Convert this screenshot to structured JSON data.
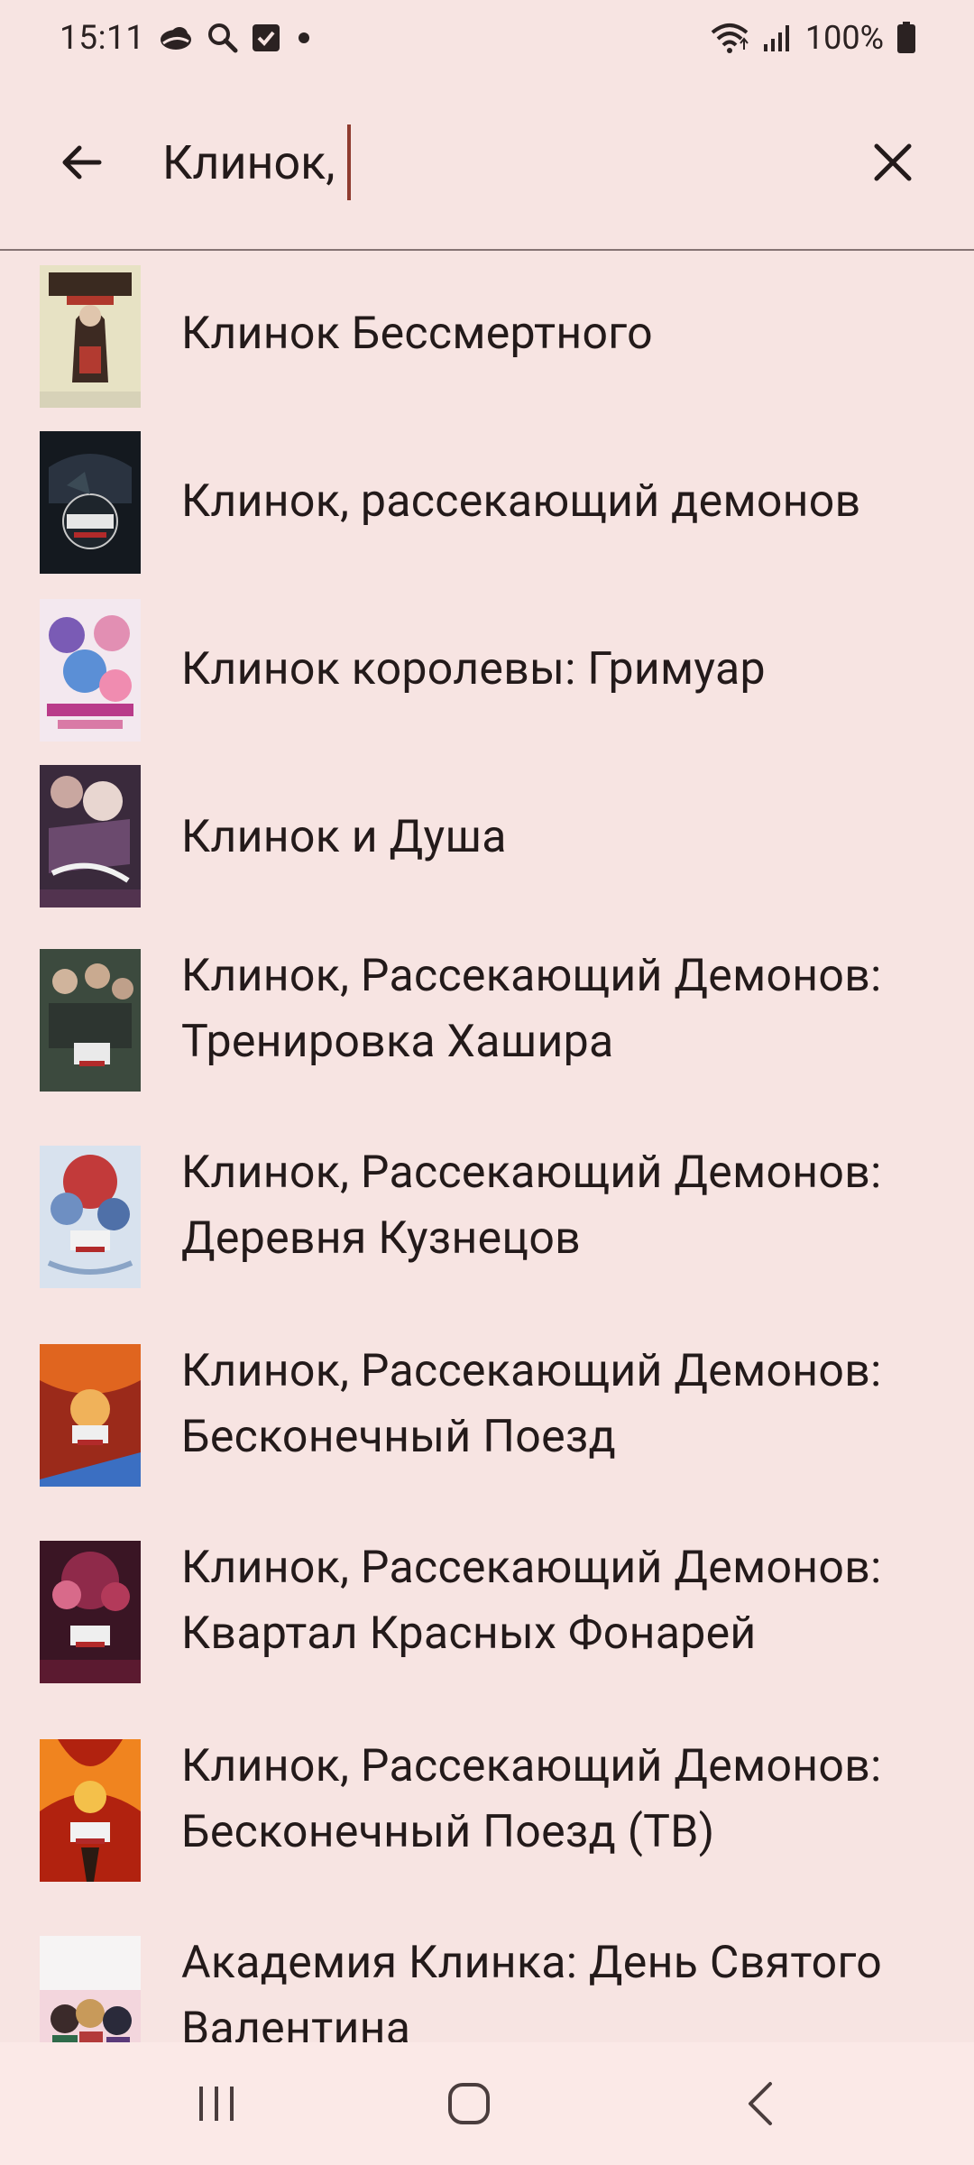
{
  "status_bar": {
    "time": "15:11",
    "battery": "100%",
    "icons": [
      "cloud-icon",
      "search-icon",
      "checkbox-icon",
      "dot-icon",
      "wifi-icon",
      "signal-icon",
      "battery-icon"
    ]
  },
  "search": {
    "query": "Клинок,",
    "back_icon": "arrow-back-icon",
    "clear_icon": "close-icon",
    "accent_color": "#8f3b2f"
  },
  "results": [
    {
      "title": "Клинок Бессмертного",
      "poster": "poster-blade-of-the-immortal"
    },
    {
      "title": "Клинок, рассекающий демонов",
      "poster": "poster-demon-slayer"
    },
    {
      "title": "Клинок королевы: Гримуар",
      "poster": "poster-queens-blade-grimoire"
    },
    {
      "title": "Клинок и Душа",
      "poster": "poster-blade-and-soul"
    },
    {
      "title": "Клинок, Рассекающий Демонов: Тренировка Хашира",
      "poster": "poster-hashira-training"
    },
    {
      "title": "Клинок, Рассекающий Демонов: Деревня Кузнецов",
      "poster": "poster-swordsmith-village"
    },
    {
      "title": "Клинок, Рассекающий Демонов: Бесконечный Поезд",
      "poster": "poster-mugen-train"
    },
    {
      "title": "Клинок, Рассекающий Демонов: Квартал Красных Фонарей",
      "poster": "poster-entertainment-district"
    },
    {
      "title": "Клинок, Рассекающий Демонов: Бесконечный Поезд (ТВ)",
      "poster": "poster-mugen-train-tv"
    },
    {
      "title": "Академия Клинка: День Святого Валентина",
      "poster": "poster-valentine"
    }
  ],
  "nav_bar": {
    "icons": [
      "recent-apps-icon",
      "home-icon",
      "back-nav-icon"
    ]
  }
}
